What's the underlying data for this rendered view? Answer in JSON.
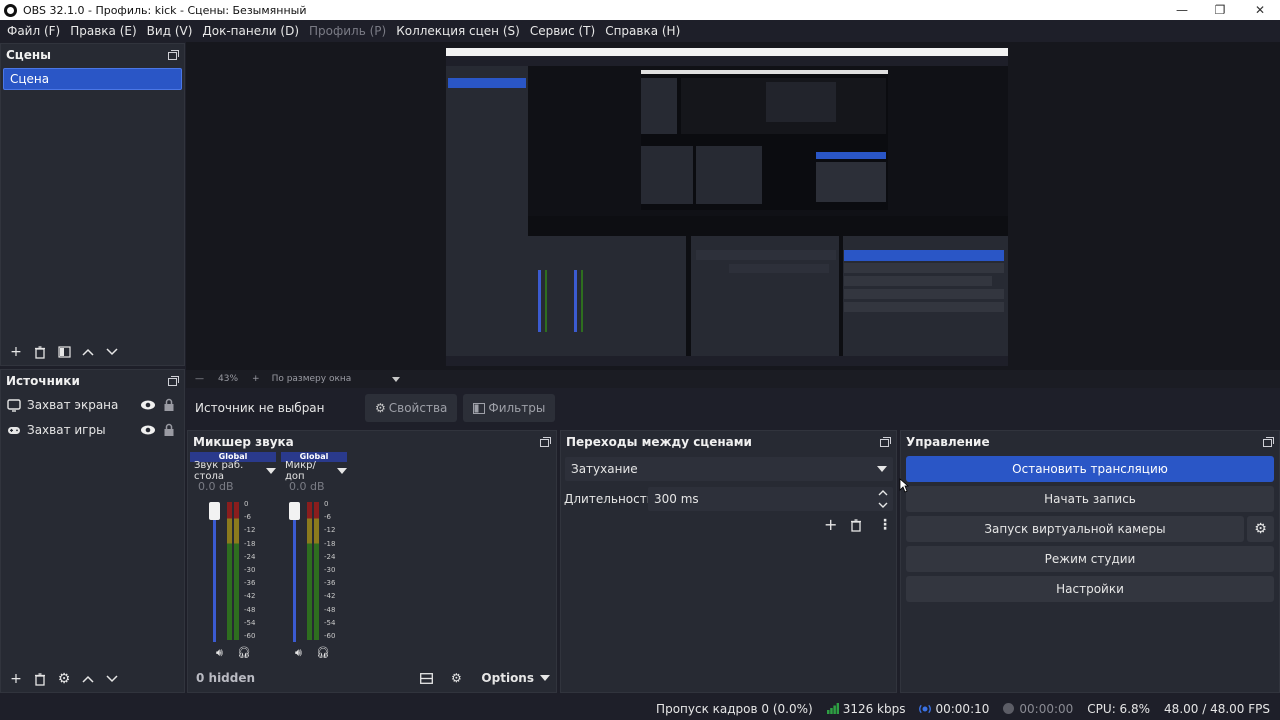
{
  "window": {
    "title": "OBS 32.1.0 - Профиль: kick - Сцены: Безымянный",
    "minimize": "—",
    "restore": "❐",
    "close": "✕"
  },
  "menu": [
    {
      "label": "Файл (F)"
    },
    {
      "label": "Правка (E)"
    },
    {
      "label": "Вид (V)"
    },
    {
      "label": "Док-панели (D)"
    },
    {
      "label": "Профиль (P)",
      "disabled": true
    },
    {
      "label": "Коллекция сцен (S)"
    },
    {
      "label": "Сервис (T)"
    },
    {
      "label": "Справка (H)"
    }
  ],
  "scenes": {
    "title": "Сцены",
    "items": [
      "Сцена"
    ]
  },
  "sources": {
    "title": "Источники",
    "items": [
      {
        "label": "Захват экрана",
        "icon": "monitor-icon"
      },
      {
        "label": "Захват игры",
        "icon": "gamepad-icon"
      }
    ]
  },
  "preview": {
    "zoom": "43%",
    "fit": "По размеру окна"
  },
  "context": {
    "no_source": "Источник не выбран",
    "properties": "Свойства",
    "filters": "Фильтры"
  },
  "mixer": {
    "title": "Микшер звука",
    "channels": [
      {
        "group": "Global",
        "name": "Звук раб. стола",
        "db": "0.0 dB",
        "volume": 1.0
      },
      {
        "group": "Global",
        "name": "Микр/доп",
        "db": "0.0 dB",
        "volume": 1.0
      }
    ],
    "scale": [
      "0",
      "-6",
      "-12",
      "-18",
      "-24",
      "-30",
      "-36",
      "-42",
      "-48",
      "-54",
      "-60"
    ],
    "hidden": "0 hidden",
    "options": "Options"
  },
  "transitions": {
    "title": "Переходы между сценами",
    "selected": "Затухание",
    "duration_label": "Длительность",
    "duration_value": "300 ms"
  },
  "controls": {
    "title": "Управление",
    "stop_stream": "Остановить трансляцию",
    "start_record": "Начать запись",
    "virtual_cam": "Запуск виртуальной камеры",
    "studio_mode": "Режим студии",
    "settings": "Настройки"
  },
  "status": {
    "dropped": "Пропуск кадров 0 (0.0%)",
    "bitrate": "3126 kbps",
    "stream_time": "00:00:10",
    "rec_time": "00:00:00",
    "cpu": "CPU: 6.8%",
    "fps": "48.00 / 48.00 FPS"
  },
  "colors": {
    "accent": "#2a56c6",
    "background": "#1e1f29",
    "dock": "#272a33"
  }
}
